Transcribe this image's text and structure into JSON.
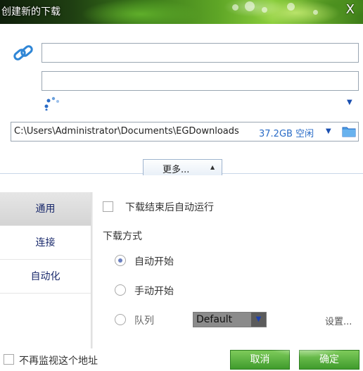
{
  "window": {
    "title": "创建新的下载",
    "close_glyph": "X"
  },
  "source": {
    "url_value": "",
    "name_value": ""
  },
  "save": {
    "path": "C:\\Users\\Administrator\\Documents\\EGDownloads",
    "free_space": "37.2GB 空闲"
  },
  "more": {
    "label": "更多..."
  },
  "tabs": [
    {
      "label": "通用",
      "active": true
    },
    {
      "label": "连接",
      "active": false
    },
    {
      "label": "自动化",
      "active": false
    }
  ],
  "general": {
    "auto_run_label": "下载结束后自动运行",
    "mode_title": "下载方式",
    "auto_start_label": "自动开始",
    "manual_start_label": "手动开始",
    "queue_label": "队列",
    "queue_value": "Default",
    "settings_label": "设置..."
  },
  "footer": {
    "no_monitor_label": "不再监视这个地址",
    "cancel_label": "取消",
    "ok_label": "确定"
  },
  "colors": {
    "accent_green": "#3f9b2c",
    "link_blue": "#2a6cc7"
  }
}
